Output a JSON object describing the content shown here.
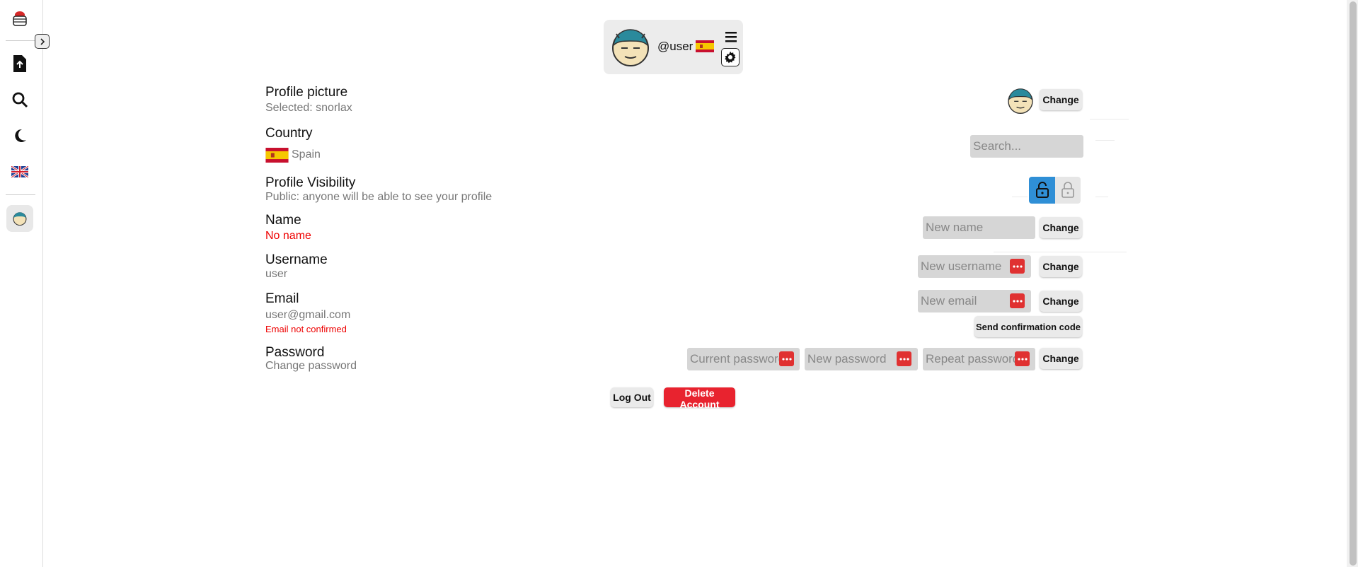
{
  "header": {
    "handle": "@user"
  },
  "settings": {
    "profile_picture": {
      "label": "Profile picture",
      "value": "Selected: snorlax",
      "button": "Change"
    },
    "country": {
      "label": "Country",
      "value": "Spain",
      "search_placeholder": "Search..."
    },
    "visibility": {
      "label": "Profile Visibility",
      "value": "Public: anyone will be able to see your profile"
    },
    "name": {
      "label": "Name",
      "value": "No name",
      "placeholder": "New name",
      "button": "Change"
    },
    "username": {
      "label": "Username",
      "value": "user",
      "placeholder": "New username",
      "button": "Change"
    },
    "email": {
      "label": "Email",
      "value": "user@gmail.com",
      "warning": "Email not confirmed",
      "placeholder": "New email",
      "button": "Change",
      "confirm_button": "Send confirmation code"
    },
    "password": {
      "label": "Password",
      "value": "Change password",
      "current_placeholder": "Current password",
      "new_placeholder": "New password",
      "repeat_placeholder": "Repeat password",
      "button": "Change"
    }
  },
  "actions": {
    "logout": "Log Out",
    "delete": "Delete Account"
  },
  "colors": {
    "accent": "#2f8fd6",
    "danger": "#e8232f",
    "error_text": "#e00000",
    "input_bg": "#d6d6d6"
  },
  "icons": [
    "app-logo-icon",
    "upload-file-icon",
    "search-icon",
    "moon-icon",
    "uk-flag-icon",
    "chevron-right-icon",
    "menu-icon",
    "gear-icon",
    "spain-flag-icon",
    "lock-open-icon",
    "lock-closed-icon",
    "password-dots-icon"
  ]
}
